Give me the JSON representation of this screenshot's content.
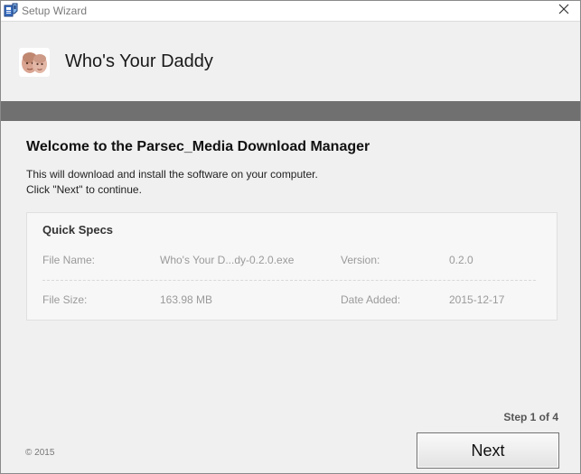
{
  "window": {
    "title": "Setup Wizard",
    "app_icon": "setup-package-icon",
    "close_icon": "close-icon"
  },
  "header": {
    "logo": "faces-avatar-icon",
    "app_name": "Who's Your Daddy"
  },
  "content": {
    "heading": "Welcome to the Parsec_Media Download Manager",
    "description_line1": "This will download and install the software on your computer.",
    "description_line2": "Click \"Next\" to continue."
  },
  "quick_specs": {
    "title": "Quick Specs",
    "file_name_label": "File Name:",
    "file_name_value": "Who's Your D...dy-0.2.0.exe",
    "version_label": "Version:",
    "version_value": "0.2.0",
    "file_size_label": "File Size:",
    "file_size_value": "163.98 MB",
    "date_added_label": "Date Added:",
    "date_added_value": "2015-12-17"
  },
  "footer": {
    "step": "Step 1 of 4",
    "copyright": "© 2015",
    "next_label": "Next"
  },
  "colors": {
    "divider_bar": "#707070",
    "background": "#f0f0f0"
  }
}
